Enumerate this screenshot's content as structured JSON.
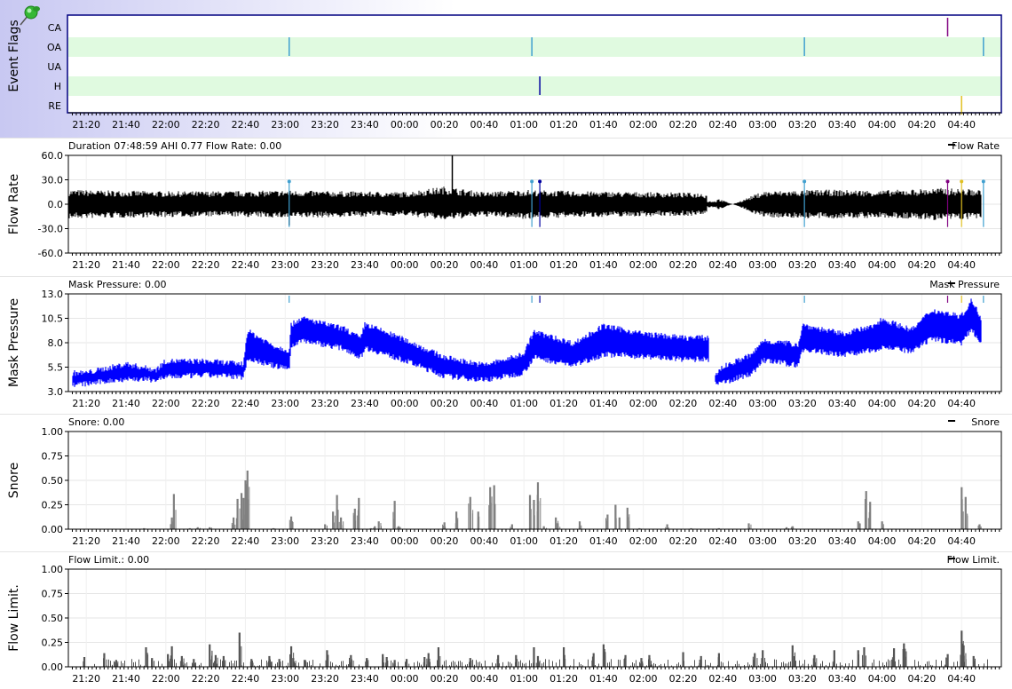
{
  "x_ticks": [
    "21:20",
    "21:40",
    "22:00",
    "22:20",
    "22:40",
    "23:00",
    "23:20",
    "23:40",
    "00:00",
    "00:20",
    "00:40",
    "01:00",
    "01:20",
    "01:40",
    "02:00",
    "02:20",
    "02:40",
    "03:00",
    "03:20",
    "03:40",
    "04:00",
    "04:20",
    "04:40"
  ],
  "x_tick_minutes": [
    1280,
    1300,
    1320,
    1340,
    1360,
    1380,
    1400,
    1420,
    1440,
    1460,
    1480,
    1500,
    1520,
    1540,
    1560,
    1580,
    1600,
    1620,
    1640,
    1660,
    1680,
    1700,
    1720
  ],
  "x_start_minute": 1271,
  "x_end_minute": 1740,
  "colors": {
    "flags_bg": "#c8c8f2",
    "row_band": "#e0fae0",
    "flow": "#000000",
    "pressure": "#0000ff",
    "snore": "#808080",
    "flow_limit": "#555555",
    "ca": "#800080",
    "oa": "#40a0d0",
    "h": "#0000a0",
    "re": "#e0c020",
    "grid": "#e6e6e6",
    "frame": "#000080"
  },
  "event_flags": {
    "title": "Event Flags",
    "rows": [
      "CA",
      "OA",
      "UA",
      "H",
      "RE"
    ],
    "events": [
      {
        "row": "CA",
        "t": "04:33"
      },
      {
        "row": "OA",
        "t": "23:02"
      },
      {
        "row": "OA",
        "t": "01:04"
      },
      {
        "row": "OA",
        "t": "03:21"
      },
      {
        "row": "OA",
        "t": "04:51"
      },
      {
        "row": "H",
        "t": "01:08"
      },
      {
        "row": "RE",
        "t": "04:40"
      }
    ]
  },
  "chart_data": [
    {
      "type": "line",
      "panel": "flow_rate",
      "ylabel": "Flow Rate",
      "header": "Duration 07:48:59 AHI 0.77 Flow Rate: 0.00",
      "legend": "Flow Rate",
      "ylim": [
        -60,
        60
      ],
      "yticks": [
        "60.0",
        "30.0",
        "0.0",
        "-30.0",
        "-60.0"
      ],
      "amplitude_envelope": {
        "x": [
          "21:11",
          "21:30",
          "22:00",
          "22:30",
          "23:00",
          "23:30",
          "00:00",
          "00:20",
          "00:40",
          "01:00",
          "01:30",
          "02:00",
          "02:30",
          "02:45",
          "03:00",
          "03:30",
          "04:00",
          "04:30",
          "04:50"
        ],
        "upper": [
          18,
          17,
          16,
          16,
          17,
          16,
          15,
          22,
          15,
          18,
          16,
          15,
          14,
          0,
          16,
          18,
          17,
          20,
          18
        ],
        "lower": [
          -18,
          -17,
          -16,
          -15,
          -17,
          -16,
          -14,
          -20,
          -15,
          -18,
          -16,
          -15,
          -14,
          0,
          -16,
          -18,
          -17,
          -20,
          -18
        ]
      },
      "spikes": [
        {
          "t": "00:24",
          "y": 60
        },
        {
          "t": "23:02",
          "y": -26
        }
      ],
      "event_markers": [
        {
          "t": "23:02",
          "flag": "OA"
        },
        {
          "t": "01:04",
          "flag": "OA"
        },
        {
          "t": "01:08",
          "flag": "H"
        },
        {
          "t": "03:21",
          "flag": "OA"
        },
        {
          "t": "04:33",
          "flag": "CA"
        },
        {
          "t": "04:40",
          "flag": "RE"
        },
        {
          "t": "04:51",
          "flag": "OA"
        }
      ]
    },
    {
      "type": "area",
      "panel": "mask_pressure",
      "ylabel": "Mask Pressure",
      "header": "Mask Pressure: 0.00",
      "legend": "Mask Pressure",
      "ylim": [
        3.0,
        13.0
      ],
      "yticks": [
        "13.0",
        "10.5",
        "8.0",
        "5.5",
        "3.0"
      ],
      "x": [
        "21:13",
        "21:20",
        "21:40",
        "21:55",
        "22:00",
        "22:20",
        "22:39",
        "22:41",
        "22:55",
        "23:02",
        "23:03",
        "23:08",
        "23:30",
        "23:38",
        "23:40",
        "24:00",
        "24:20",
        "24:40",
        "24:55",
        "25:00",
        "25:05",
        "25:25",
        "25:40",
        "26:00",
        "26:20",
        "26:33",
        "26:36",
        "26:40",
        "26:55",
        "27:00",
        "27:18",
        "27:20",
        "27:40",
        "27:55",
        "28:00",
        "28:15",
        "28:25",
        "28:40",
        "28:45",
        "28:50"
      ],
      "high": [
        4.9,
        4.9,
        5.8,
        5.2,
        6.1,
        6.1,
        5.8,
        9.2,
        7.6,
        7.2,
        9.8,
        10.5,
        9.4,
        8.4,
        9.9,
        8.3,
        6.5,
        5.7,
        6.5,
        6.9,
        9.1,
        7.9,
        9.7,
        8.9,
        8.5,
        8.5,
        4.7,
        5.5,
        6.8,
        8.2,
        7.8,
        9.8,
        8.9,
        9.6,
        10.4,
        9.3,
        11.3,
        10.7,
        12.3,
        10.5
      ],
      "low": [
        3.7,
        3.8,
        4.3,
        4.2,
        4.5,
        4.7,
        4.5,
        6.4,
        5.6,
        5.4,
        7.5,
        8.3,
        7.4,
        6.5,
        7.5,
        6.2,
        4.6,
        4.2,
        4.7,
        5.0,
        6.5,
        5.7,
        6.8,
        6.6,
        6.3,
        6.3,
        3.7,
        3.9,
        4.9,
        6.2,
        5.7,
        7.3,
        6.8,
        7.2,
        7.6,
        7.1,
        8.4,
        8.0,
        9.4,
        8.0
      ],
      "gap": [
        "02:33",
        "02:36"
      ]
    },
    {
      "type": "bar",
      "panel": "snore",
      "ylabel": "Snore",
      "header": "Snore: 0.00",
      "legend": "Snore",
      "ylim": [
        0,
        1.0
      ],
      "yticks": [
        "1.00",
        "0.75",
        "0.50",
        "0.25",
        "0.00"
      ],
      "x": [
        "21:49",
        "22:03",
        "22:04",
        "22:12",
        "22:16",
        "22:22",
        "22:34",
        "22:36",
        "22:38",
        "22:39",
        "22:40",
        "22:41",
        "22:54",
        "23:03",
        "23:20",
        "23:24",
        "23:26",
        "23:28",
        "23:35",
        "23:37",
        "23:43",
        "23:45",
        "23:47",
        "23:55",
        "23:57",
        "24:20",
        "24:26",
        "24:33",
        "24:37",
        "24:43",
        "24:45",
        "24:54",
        "25:03",
        "25:05",
        "25:07",
        "25:10",
        "25:16",
        "25:17",
        "25:28",
        "25:42",
        "25:46",
        "25:48",
        "25:52",
        "25:58",
        "26:12",
        "26:24",
        "26:38",
        "26:53",
        "27:12",
        "27:15",
        "27:48",
        "27:52",
        "27:54",
        "28:00",
        "28:40",
        "28:42",
        "28:49"
      ],
      "values": [
        0.01,
        0.12,
        0.36,
        0.01,
        0.02,
        0.02,
        0.12,
        0.31,
        0.37,
        0.32,
        0.5,
        0.6,
        0.01,
        0.13,
        0.05,
        0.18,
        0.35,
        0.12,
        0.21,
        0.32,
        0.01,
        0.03,
        0.08,
        0.29,
        0.03,
        0.07,
        0.18,
        0.33,
        0.18,
        0.43,
        0.45,
        0.05,
        0.35,
        0.3,
        0.48,
        0.03,
        0.12,
        0.06,
        0.08,
        0.15,
        0.25,
        0.12,
        0.22,
        0.01,
        0.05,
        0.01,
        0.01,
        0.06,
        0.02,
        0.03,
        0.08,
        0.39,
        0.28,
        0.08,
        0.43,
        0.33,
        0.05
      ]
    },
    {
      "type": "bar",
      "panel": "flow_limit",
      "ylabel": "Flow Limit.",
      "header": "Flow Limit.: 0.00",
      "legend": "Flow Limit.",
      "ylim": [
        0,
        1.0
      ],
      "yticks": [
        "1.00",
        "0.75",
        "0.50",
        "0.25",
        "0.00"
      ],
      "x": [
        "21:19",
        "21:29",
        "21:35",
        "21:50",
        "21:53",
        "22:01",
        "22:03",
        "22:08",
        "22:14",
        "22:22",
        "22:25",
        "22:29",
        "22:37",
        "22:43",
        "22:52",
        "22:57",
        "23:03",
        "23:04",
        "23:10",
        "23:21",
        "23:33",
        "23:41",
        "23:49",
        "23:51",
        "23:55",
        "24:01",
        "24:10",
        "24:12",
        "24:17",
        "24:33",
        "24:47",
        "24:56",
        "25:05",
        "25:07",
        "25:20",
        "25:35",
        "25:40",
        "25:51",
        "25:59",
        "26:03",
        "26:20",
        "26:29",
        "26:38",
        "26:56",
        "27:00",
        "27:15",
        "27:26",
        "27:36",
        "27:48",
        "27:51",
        "28:06",
        "28:11",
        "28:33",
        "28:40",
        "28:41",
        "28:46"
      ],
      "values": [
        0.1,
        0.14,
        0.07,
        0.2,
        0.09,
        0.13,
        0.21,
        0.11,
        0.08,
        0.23,
        0.12,
        0.11,
        0.35,
        0.08,
        0.11,
        0.08,
        0.21,
        0.09,
        0.07,
        0.17,
        0.12,
        0.09,
        0.13,
        0.1,
        0.07,
        0.08,
        0.1,
        0.14,
        0.2,
        0.09,
        0.12,
        0.12,
        0.2,
        0.11,
        0.2,
        0.14,
        0.23,
        0.12,
        0.09,
        0.12,
        0.15,
        0.11,
        0.14,
        0.14,
        0.17,
        0.22,
        0.12,
        0.17,
        0.17,
        0.2,
        0.19,
        0.24,
        0.13,
        0.37,
        0.22,
        0.11
      ]
    }
  ]
}
